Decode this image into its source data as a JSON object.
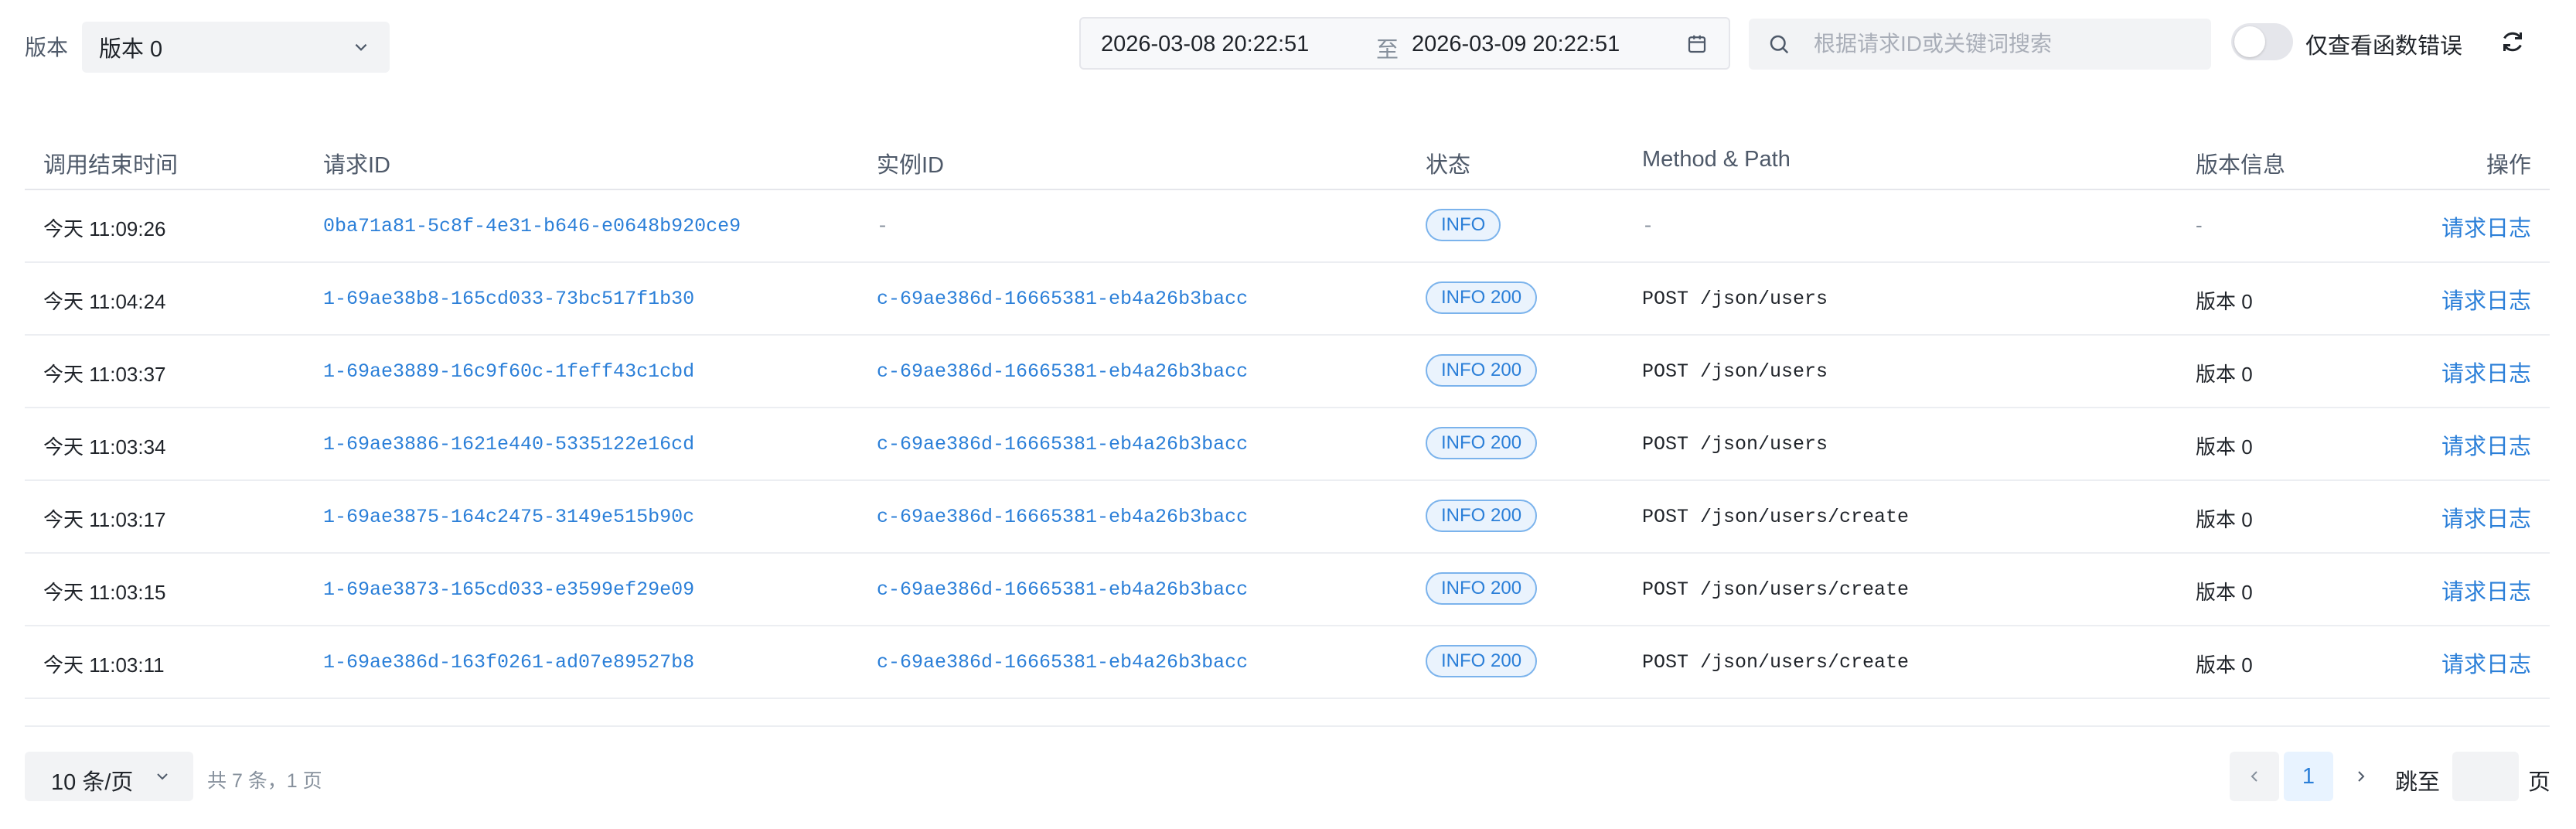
{
  "filters": {
    "version_label": "版本",
    "version_value": "版本 0",
    "date_start": "2026-03-08 20:22:51",
    "date_sep": "至",
    "date_end": "2026-03-09 20:22:51",
    "search_placeholder": "根据请求ID或关键词搜索",
    "error_toggle_label": "仅查看函数错误"
  },
  "table": {
    "columns": {
      "time": "调用结束时间",
      "request_id": "请求ID",
      "instance_id": "实例ID",
      "status": "状态",
      "method_path": "Method & Path",
      "version": "版本信息",
      "action": "操作"
    },
    "rows": [
      {
        "time": "今天 11:09:26",
        "request_id": "0ba71a81-5c8f-4e31-b646-e0648b920ce9",
        "instance_id": "-",
        "status": "INFO",
        "method_path": "-",
        "version": "-",
        "action": "请求日志"
      },
      {
        "time": "今天 11:04:24",
        "request_id": "1-69ae38b8-165cd033-73bc517f1b30",
        "instance_id": "c-69ae386d-16665381-eb4a26b3bacc",
        "status": "INFO 200",
        "method_path": "POST /json/users",
        "version": "版本 0",
        "action": "请求日志"
      },
      {
        "time": "今天 11:03:37",
        "request_id": "1-69ae3889-16c9f60c-1feff43c1cbd",
        "instance_id": "c-69ae386d-16665381-eb4a26b3bacc",
        "status": "INFO 200",
        "method_path": "POST /json/users",
        "version": "版本 0",
        "action": "请求日志"
      },
      {
        "time": "今天 11:03:34",
        "request_id": "1-69ae3886-1621e440-5335122e16cd",
        "instance_id": "c-69ae386d-16665381-eb4a26b3bacc",
        "status": "INFO 200",
        "method_path": "POST /json/users",
        "version": "版本 0",
        "action": "请求日志"
      },
      {
        "time": "今天 11:03:17",
        "request_id": "1-69ae3875-164c2475-3149e515b90c",
        "instance_id": "c-69ae386d-16665381-eb4a26b3bacc",
        "status": "INFO 200",
        "method_path": "POST /json/users/create",
        "version": "版本 0",
        "action": "请求日志"
      },
      {
        "time": "今天 11:03:15",
        "request_id": "1-69ae3873-165cd033-e3599ef29e09",
        "instance_id": "c-69ae386d-16665381-eb4a26b3bacc",
        "status": "INFO 200",
        "method_path": "POST /json/users/create",
        "version": "版本 0",
        "action": "请求日志"
      },
      {
        "time": "今天 11:03:11",
        "request_id": "1-69ae386d-163f0261-ad07e89527b8",
        "instance_id": "c-69ae386d-16665381-eb4a26b3bacc",
        "status": "INFO 200",
        "method_path": "POST /json/users/create",
        "version": "版本 0",
        "action": "请求日志"
      }
    ]
  },
  "pagination": {
    "page_size": "10 条/页",
    "total_text": "共 7 条，1 页",
    "current_page": "1",
    "jump_label": "跳至",
    "page_unit": "页"
  },
  "colors": {
    "link": "#2b7fd8",
    "badge_bg": "#eaf3fd",
    "badge_border": "#7bb3ec"
  }
}
